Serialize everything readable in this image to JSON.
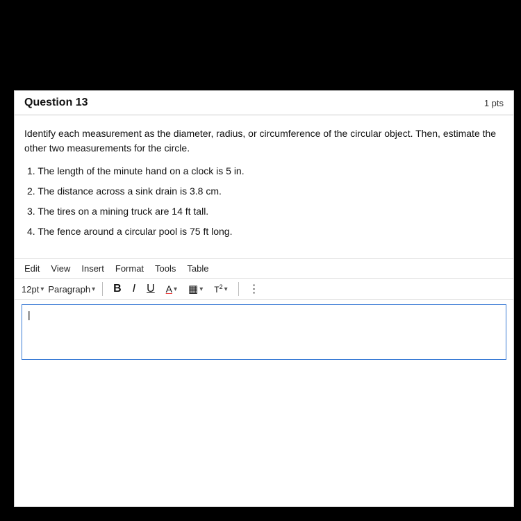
{
  "header": {
    "question_number": "Question 13",
    "pts": "1 pts"
  },
  "body": {
    "intro": "Identify each measurement as the diameter, radius, or circumference of the circular object. Then, estimate the other two measurements for the circle.",
    "items": [
      "1. The length of the minute hand on a clock is 5 in.",
      "2. The distance across a sink drain is 3.8 cm.",
      "3. The tires on a mining truck are 14 ft tall.",
      "4. The fence around a circular pool is 75 ft long."
    ]
  },
  "menubar": {
    "items": [
      "Edit",
      "View",
      "Insert",
      "Format",
      "Tools",
      "Table"
    ]
  },
  "toolbar": {
    "font_size": "12pt",
    "font_size_chevron": "▾",
    "paragraph": "Paragraph",
    "paragraph_chevron": "▾",
    "bold_label": "B",
    "italic_label": "I",
    "underline_label": "U",
    "font_color_label": "A",
    "highlight_label": "⌶",
    "superscript_label": "T²",
    "more_label": "⋮"
  },
  "answer_area": {
    "cursor": "|"
  }
}
